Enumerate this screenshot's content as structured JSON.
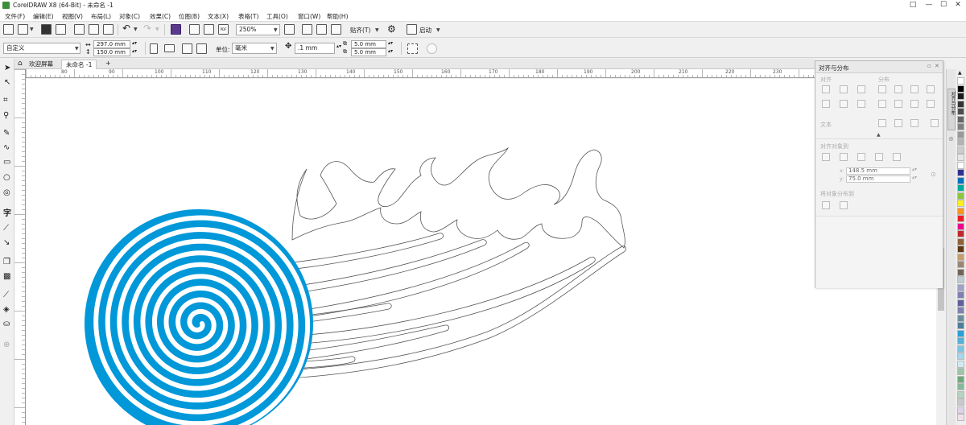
{
  "window": {
    "title": "CorelDRAW X8 (64-Bit) - 未命名 -1",
    "controls": [
      "□",
      "—",
      "☐",
      "✕"
    ]
  },
  "menu": [
    "文件(F)",
    "编辑(E)",
    "视图(V)",
    "布局(L)",
    "对象(C)",
    "效果(C)",
    "位图(B)",
    "文本(X)",
    "表格(T)",
    "工具(O)",
    "窗口(W)",
    "帮助(H)"
  ],
  "toolbar": {
    "zoom": "250%",
    "snap_label": "贴齐(T)",
    "launch_label": "启动",
    "pdf_tag": "PDF"
  },
  "property_bar": {
    "page_size": "自定义",
    "width": "297.0 mm",
    "height": "150.0 mm",
    "units_label": "单位:",
    "units_value": "毫米",
    "nudge": ".1 mm",
    "dup_x": "5.0 mm",
    "dup_y": "5.0 mm"
  },
  "doc_tabs": {
    "welcome": "欢迎屏幕",
    "document": "未命名 -1"
  },
  "ruler": {
    "unit": "毫米",
    "labels": [
      "80",
      "90",
      "100",
      "110",
      "120",
      "130",
      "140",
      "150",
      "160",
      "170",
      "180",
      "190",
      "200",
      "210",
      "220",
      "230"
    ]
  },
  "docker": {
    "title": "对齐与分布",
    "side_tab": "对齐与分布",
    "align_label": "对齐",
    "distribute_label": "分布",
    "text_label": "文本",
    "align_objects_to": "对齐对象到",
    "x_value": "148.5 mm",
    "y_value": "75.0 mm",
    "distribute_objects_to": "将对象分布到"
  },
  "colors": {
    "spiral_blue": "#0098d9",
    "palette": [
      "#ffffff",
      "#000000",
      "#1a1a1a",
      "#333333",
      "#4d4d4d",
      "#666666",
      "#808080",
      "#999999",
      "#b3b3b3",
      "#cccccc",
      "#e6e6e6",
      "#ffffff",
      "#2e3192",
      "#0071bc",
      "#00a99d",
      "#8cc63f",
      "#fcee21",
      "#f7931e",
      "#ed1c24",
      "#ec008c",
      "#c1272d",
      "#8c6239",
      "#603813",
      "#c69c6d",
      "#998675",
      "#736357",
      "#bdccd4",
      "#a0a0c8",
      "#7f7fb2",
      "#5f5f9c",
      "#8080b0",
      "#6b8e9e",
      "#4a7e9a",
      "#2a9fd6",
      "#56b0d8",
      "#7fc4e0",
      "#a6d6ea",
      "#cfe9f4",
      "#9ec4a6",
      "#6fa87a",
      "#86b99a",
      "#b7d2c0",
      "#c9c9c9",
      "#ddd3e8",
      "#f0e0ec"
    ]
  }
}
